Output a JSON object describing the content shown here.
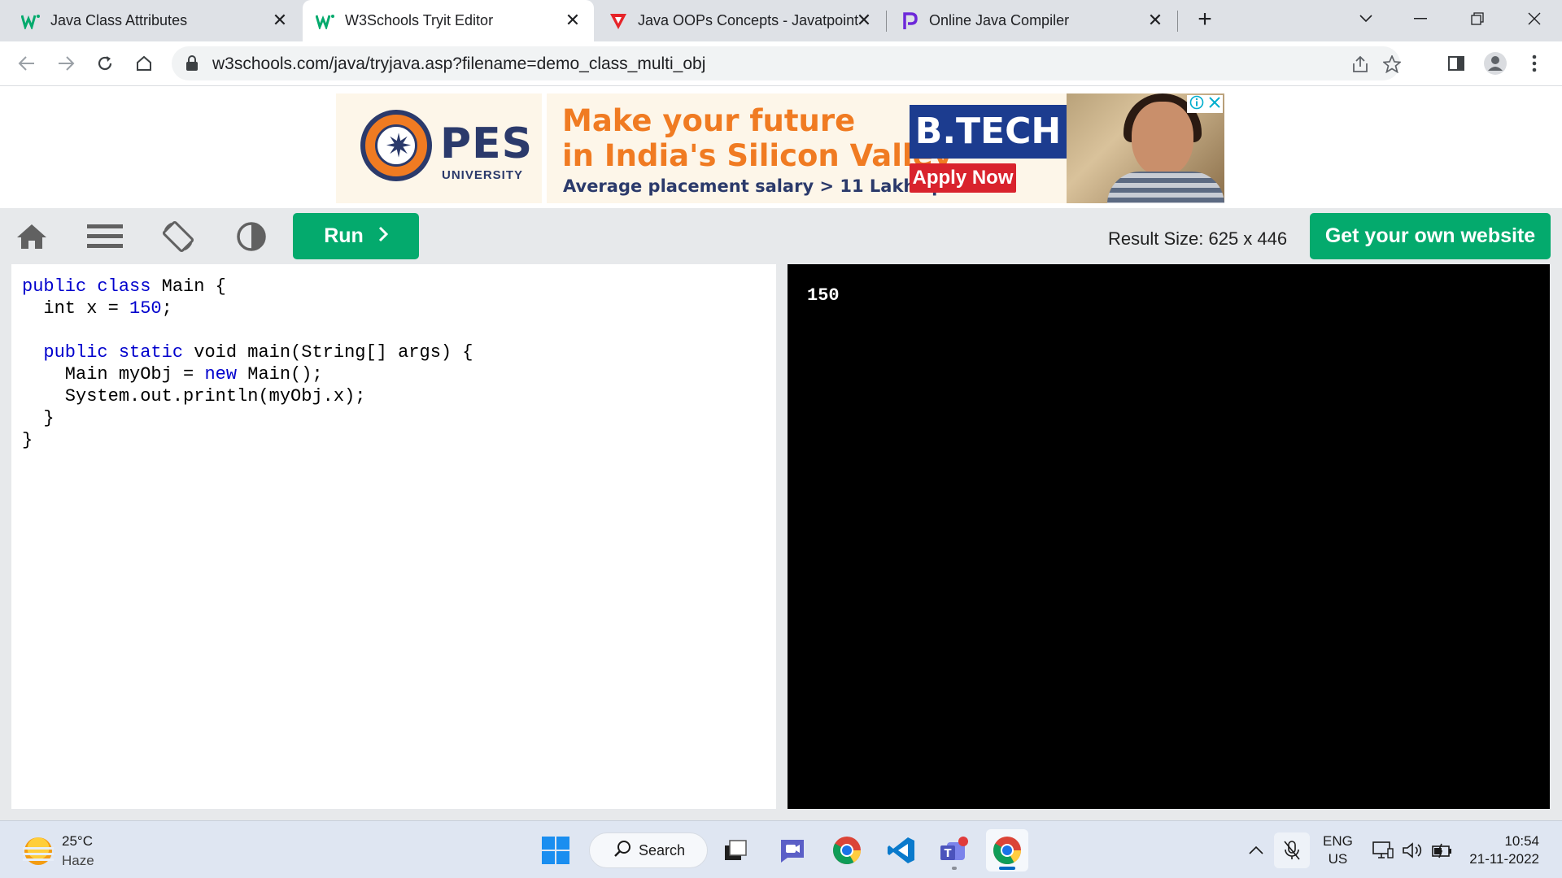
{
  "browser": {
    "tabs": [
      {
        "title": "Java Class Attributes",
        "icon": "w3schools-icon",
        "active": false
      },
      {
        "title": "W3Schools Tryit Editor",
        "icon": "w3schools-icon",
        "active": true
      },
      {
        "title": "Java OOPs Concepts - Javatpoint",
        "icon": "javatpoint-icon",
        "active": false
      },
      {
        "title": "Online Java Compiler",
        "icon": "programiz-icon",
        "active": false
      }
    ],
    "url": "w3schools.com/java/tryjava.asp?filename=demo_class_multi_obj"
  },
  "ad": {
    "brand": "PES",
    "brand_sub": "UNIVERSITY",
    "headline_1": "Make your future",
    "headline_2": "in India's Silicon Valley",
    "subline": "Average placement salary > 11 Lakhs pa",
    "badge": "B.TECH",
    "cta": "Apply Now",
    "colors": {
      "orange": "#f07b22",
      "navy": "#2b3a6b",
      "blue": "#1c3c8f",
      "red": "#d9232d"
    }
  },
  "tryit": {
    "run_label": "Run",
    "result_size": "Result Size: 625 x 446",
    "own_website_label": "Get your own website",
    "accent": "#04aa6d"
  },
  "editor": {
    "code": {
      "l1_kw1": "public",
      "l1_kw2": "class",
      "l1_rest": " Main {",
      "l2_a": "  int x = ",
      "l2_num": "150",
      "l2_b": ";",
      "l4_kw1": "public",
      "l4_kw2": "static",
      "l4_rest": " void main(String[] args) {",
      "l5_a": "    Main myObj = ",
      "l5_kw": "new",
      "l5_b": " Main();",
      "l6": "    System.out.println(myObj.x);",
      "l7": "  }",
      "l8": "}"
    }
  },
  "result": {
    "output": "150"
  },
  "taskbar": {
    "weather_temp": "25°C",
    "weather_cond": "Haze",
    "search_label": "Search",
    "lang_1": "ENG",
    "lang_2": "US",
    "time": "10:54",
    "date": "21-11-2022"
  }
}
